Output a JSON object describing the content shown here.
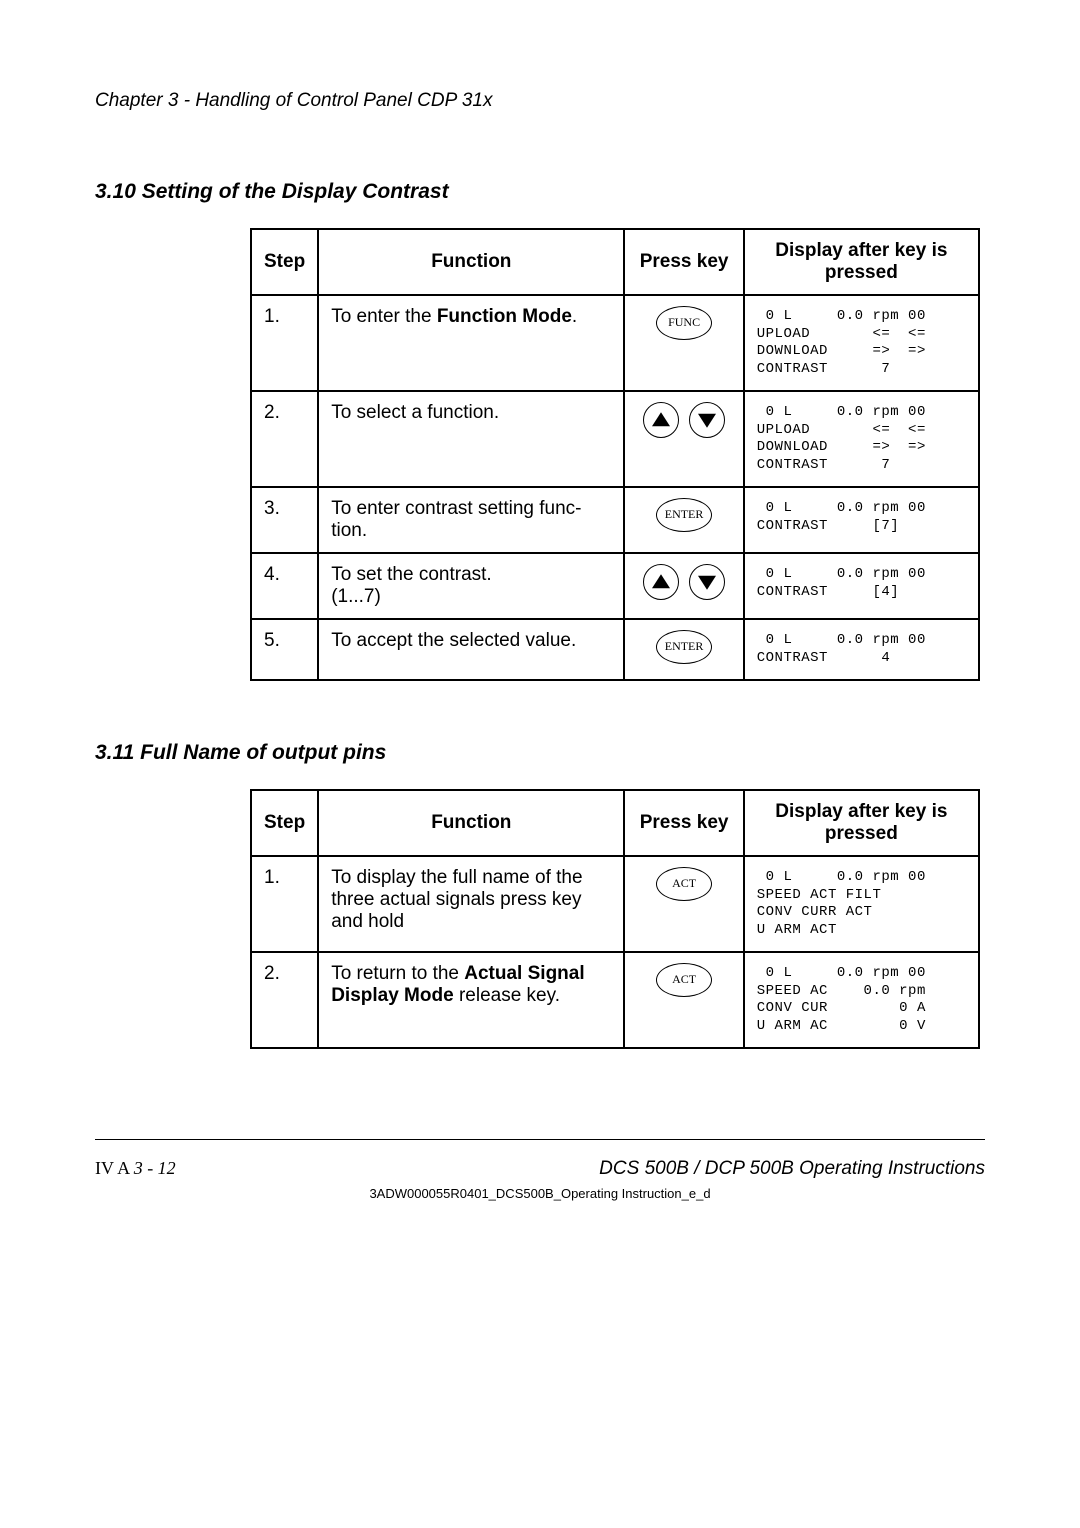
{
  "chapter": "Chapter 3 - Handling of Control Panel CDP 31x",
  "section_3_10": {
    "title": "3.10 Setting of the Display Contrast",
    "headers": {
      "step": "Step",
      "func": "Function",
      "key": "Press key",
      "disp": "Display after key is pressed"
    },
    "rows": [
      {
        "step": "1.",
        "func_pre": "To enter the ",
        "func_bold": "Function Mode",
        "func_post": ".",
        "key": "FUNC",
        "lcd": " 0 L     0.0 rpm 00\nUPLOAD       <=  <=\nDOWNLOAD     =>  =>\nCONTRAST      7"
      },
      {
        "step": "2.",
        "func": "To select a function.",
        "key": "arrows",
        "lcd": " 0 L     0.0 rpm 00\nUPLOAD       <=  <=\nDOWNLOAD     =>  =>\nCONTRAST      7"
      },
      {
        "step": "3.",
        "func": "To enter contrast setting func-\ntion.",
        "key": "ENTER",
        "lcd": " 0 L     0.0 rpm 00\nCONTRAST     [7]"
      },
      {
        "step": "4.",
        "func": "To set the contrast.\n(1...7)",
        "key": "arrows",
        "lcd": " 0 L     0.0 rpm 00\nCONTRAST     [4]"
      },
      {
        "step": "5.",
        "func": "To accept the selected value.",
        "key": "ENTER",
        "lcd": " 0 L     0.0 rpm 00\nCONTRAST      4"
      }
    ]
  },
  "section_3_11": {
    "title": "3.11 Full Name of output pins",
    "headers": {
      "step": "Step",
      "func": "Function",
      "key": "Press key",
      "disp": "Display after key is pressed"
    },
    "rows": [
      {
        "step": "1.",
        "func": "To display the full name of the\nthree actual signals press key\nand hold",
        "key": "ACT",
        "lcd": " 0 L     0.0 rpm 00\nSPEED ACT FILT\nCONV CURR ACT\nU ARM ACT"
      },
      {
        "step": "2.",
        "func_pre": "To return to the ",
        "func_bold": "Actual Signal Display Mode",
        "func_post": " release key.",
        "key": "ACT",
        "lcd": " 0 L     0.0 rpm 00\nSPEED AC    0.0 rpm\nCONV CUR        0 A\nU ARM AC        0 V"
      }
    ]
  },
  "footer": {
    "prefix": "IV A ",
    "pagepart": "3 - 12",
    "right": "DCS 500B / DCP 500B Operating Instructions",
    "doc": "3ADW000055R0401_DCS500B_Operating Instruction_e_d"
  }
}
